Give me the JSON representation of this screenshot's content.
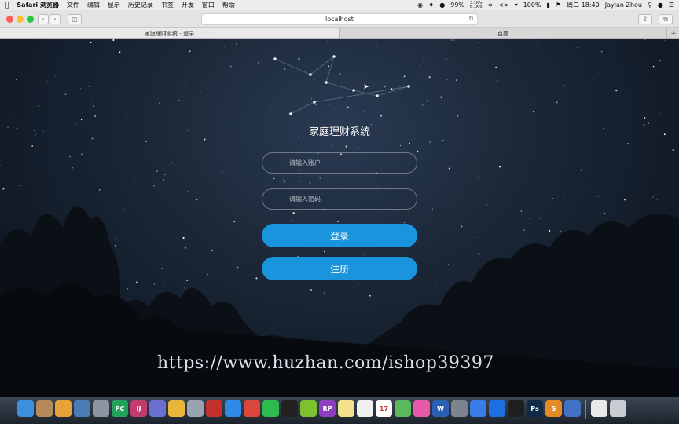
{
  "menubar": {
    "apple": "",
    "items": [
      "Safari 浏览器",
      "文件",
      "编辑",
      "显示",
      "历史记录",
      "书签",
      "开发",
      "窗口",
      "帮助"
    ],
    "battery": "99%",
    "net_up": "3.1K/s",
    "net_down": "6.1K/s",
    "charge": "100%",
    "clock": "周二 18:40",
    "user": "Jaylan Zhou"
  },
  "browser": {
    "url": "localhost",
    "tabs": [
      {
        "label": "家庭理财系统 - 登录",
        "active": true
      },
      {
        "label": "百度",
        "active": false
      }
    ]
  },
  "login": {
    "title": "家庭理财系统",
    "account_placeholder": "请输入账户",
    "password_placeholder": "请输入密码",
    "login_label": "登录",
    "register_label": "注册"
  },
  "watermark": "https://www.huzhan.com/ishop39397",
  "colors": {
    "primary_button": "#1a94dc",
    "background": "#1b2737"
  },
  "dock": [
    {
      "name": "finder-icon",
      "label": "",
      "color": "#3d8fe0"
    },
    {
      "name": "notes-icon",
      "label": "",
      "color": "#b48a5a"
    },
    {
      "name": "photos-icon",
      "label": "",
      "color": "#e8a23a"
    },
    {
      "name": "preview-icon",
      "label": "",
      "color": "#4a7cb5"
    },
    {
      "name": "launchpad-icon",
      "label": "",
      "color": "#8d95a3"
    },
    {
      "name": "pycharm-icon",
      "label": "PC",
      "color": "#23a35a"
    },
    {
      "name": "intellij-icon",
      "label": "IJ",
      "color": "#c23d6b"
    },
    {
      "name": "database-icon",
      "label": "",
      "color": "#6b6fd0"
    },
    {
      "name": "sequel-icon",
      "label": "",
      "color": "#e6b53a"
    },
    {
      "name": "utility-icon",
      "label": "",
      "color": "#9aa4b1"
    },
    {
      "name": "redis-icon",
      "label": "",
      "color": "#c4302b"
    },
    {
      "name": "safari-icon",
      "label": "",
      "color": "#2e8be6"
    },
    {
      "name": "clipper-icon",
      "label": "",
      "color": "#d9463a"
    },
    {
      "name": "wechat-icon",
      "label": "",
      "color": "#2dbb4d"
    },
    {
      "name": "qq-icon",
      "label": "",
      "color": "#222222"
    },
    {
      "name": "music-player-icon",
      "label": "",
      "color": "#7dc12f"
    },
    {
      "name": "axure-icon",
      "label": "RP",
      "color": "#8c3fbe"
    },
    {
      "name": "notepad-icon",
      "label": "",
      "color": "#f2e08a"
    },
    {
      "name": "sticky-icon",
      "label": "",
      "color": "#f0f0f0"
    },
    {
      "name": "calendar-icon",
      "label": "17",
      "color": "#ffffff"
    },
    {
      "name": "maps-icon",
      "label": "",
      "color": "#5cb85c"
    },
    {
      "name": "itunes-icon",
      "label": "",
      "color": "#e85aa8"
    },
    {
      "name": "word-icon",
      "label": "W",
      "color": "#2b5fb4"
    },
    {
      "name": "system-preferences-icon",
      "label": "",
      "color": "#7b848f"
    },
    {
      "name": "baidu-netdisk-icon",
      "label": "",
      "color": "#3a7ce8"
    },
    {
      "name": "teamviewer-icon",
      "label": "",
      "color": "#1d6fe0"
    },
    {
      "name": "qq2-icon",
      "label": "",
      "color": "#1f1f1f"
    },
    {
      "name": "photoshop-icon",
      "label": "Ps",
      "color": "#0d2a47"
    },
    {
      "name": "sublime-icon",
      "label": "S",
      "color": "#e48b26"
    },
    {
      "name": "browser-icon",
      "label": "",
      "color": "#4270c2"
    },
    {
      "name": "document-icon",
      "label": "",
      "color": "#e9e9e9"
    },
    {
      "name": "trash-icon",
      "label": "",
      "color": "#c9ccd0"
    }
  ]
}
